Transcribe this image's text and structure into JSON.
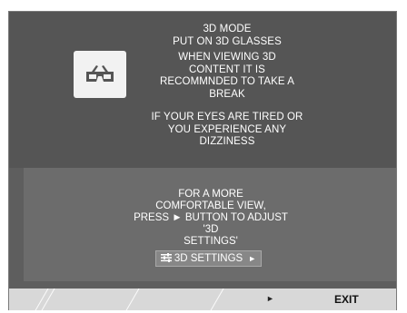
{
  "top_message": {
    "lines_group1": [
      "3D MODE",
      "PUT ON 3D GLASSES",
      "WHEN VIEWING 3D",
      "CONTENT IT IS",
      "RECOMMNDED TO TAKE A",
      "BREAK"
    ],
    "lines_group2": [
      "IF YOUR EYES ARE TIRED OR",
      "YOU EXPERIENCE ANY",
      "DIZZINESS"
    ]
  },
  "bottom_message": {
    "lines": [
      "FOR A MORE",
      "COMFORTABLE VIEW,",
      "PRESS ► BUTTON TO ADJUST '3D",
      "SETTINGS'"
    ]
  },
  "settings_button": {
    "icon": "sliders-icon",
    "label": "3D SETTINGS",
    "arrow": "►"
  },
  "footer": {
    "arrow": "►",
    "exit_label": "EXIT"
  },
  "icons": {
    "glasses": "3d-glasses-icon"
  },
  "colors": {
    "panel_dark": "#555555",
    "panel_mid": "#6c6c6c",
    "button": "#878787",
    "footer": "#d8d8d8"
  }
}
